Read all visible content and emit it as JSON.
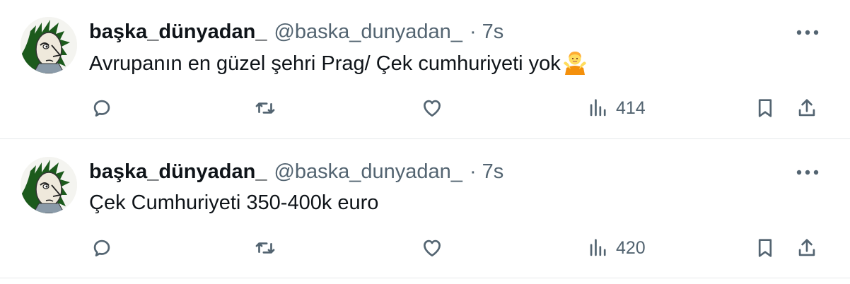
{
  "tweets": [
    {
      "display_name": "başka_dünyadan_",
      "handle": "@baska_dunyadan_",
      "separator": "·",
      "time": "7s",
      "text": "Avrupanın en güzel şehri Prag/ Çek cumhuriyeti yok",
      "emoji": "person-shrugging-emoji",
      "views": "414"
    },
    {
      "display_name": "başka_dünyadan_",
      "handle": "@baska_dunyadan_",
      "separator": "·",
      "time": "7s",
      "text": "Çek Cumhuriyeti 350-400k euro",
      "emoji": null,
      "views": "420"
    }
  ],
  "icons": {
    "more": "more-icon",
    "reply": "reply-icon",
    "retweet": "retweet-icon",
    "like": "like-icon",
    "views": "views-icon",
    "bookmark": "bookmark-icon",
    "share": "share-icon"
  },
  "colors": {
    "text_primary": "#0f1419",
    "text_secondary": "#536471",
    "divider": "#e6e9eb"
  }
}
